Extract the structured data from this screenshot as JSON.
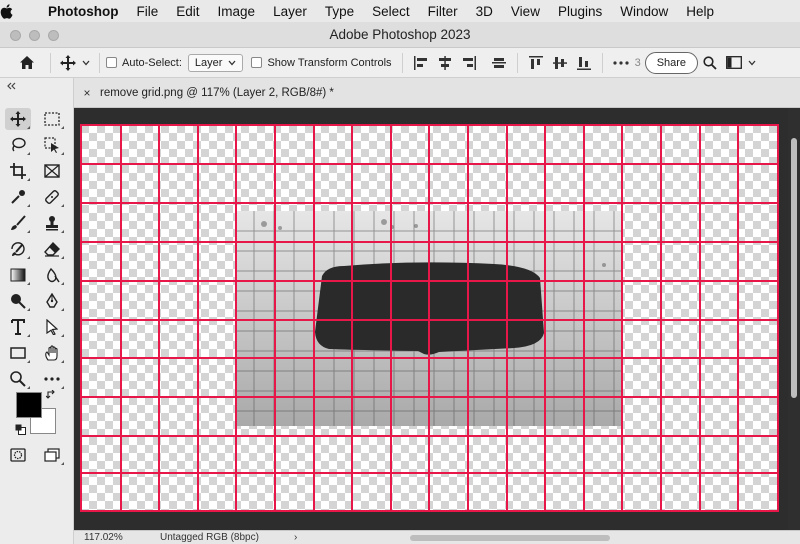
{
  "menubar": {
    "app_name": "Photoshop",
    "items": [
      "File",
      "Edit",
      "Image",
      "Layer",
      "Type",
      "Select",
      "Filter",
      "3D",
      "View",
      "Plugins",
      "Window",
      "Help"
    ]
  },
  "window": {
    "title": "Adobe Photoshop 2023"
  },
  "options_bar": {
    "auto_select_label": "Auto-Select:",
    "auto_select_value": "Layer",
    "show_transform_label": "Show Transform Controls",
    "three_d_mode_label": "3",
    "share_label": "Share"
  },
  "document": {
    "tab_title": "remove grid.png @ 117% (Layer 2, RGB/8#) *",
    "close_glyph": "×"
  },
  "status_bar": {
    "zoom": "117.02%",
    "color_profile": "Untagged RGB (8bpc)",
    "arrow": "›"
  },
  "colors": {
    "guide": "#e8174a",
    "canvas_bg": "#2d2d2d",
    "foreground_swatch": "#000000",
    "background_swatch": "#ffffff"
  },
  "tools": [
    "move-tool",
    "marquee-tool",
    "lasso-tool",
    "object-select-tool",
    "crop-tool",
    "frame-tool",
    "eyedropper-tool",
    "healing-brush-tool",
    "brush-tool",
    "clone-stamp-tool",
    "history-brush-tool",
    "eraser-tool",
    "gradient-tool",
    "blur-tool",
    "dodge-tool",
    "pen-tool",
    "type-tool",
    "path-select-tool",
    "rectangle-tool",
    "hand-tool",
    "zoom-tool",
    "more-tools"
  ]
}
